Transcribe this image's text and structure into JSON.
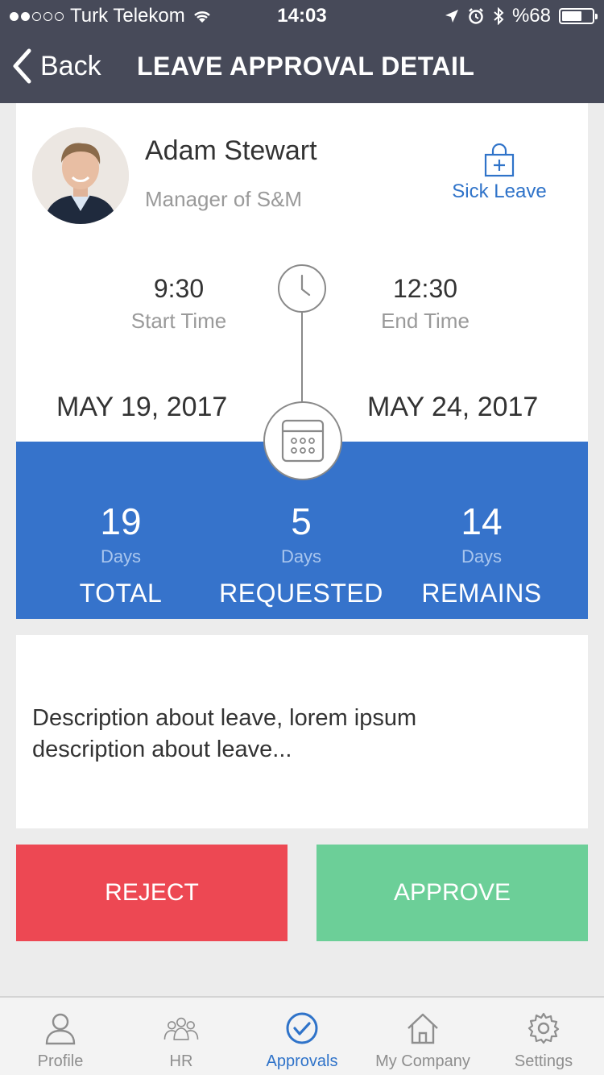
{
  "status_bar": {
    "carrier": "Turk Telekom",
    "time": "14:03",
    "battery": "%68",
    "battery_level": 0.68
  },
  "nav": {
    "back_label": "Back",
    "title": "LEAVE APPROVAL DETAIL"
  },
  "employee": {
    "name": "Adam Stewart",
    "role": "Manager of S&M"
  },
  "leave": {
    "type": "Sick Leave",
    "start_time": "9:30",
    "start_time_label": "Start Time",
    "end_time": "12:30",
    "end_time_label": "End Time",
    "start_date": "MAY 19, 2017",
    "end_date": "MAY 24, 2017"
  },
  "summary": {
    "unit": "Days",
    "total": {
      "value": "19",
      "caption": "TOTAL"
    },
    "requested": {
      "value": "5",
      "caption": "REQUESTED"
    },
    "remains": {
      "value": "14",
      "caption": "REMAINS"
    }
  },
  "description": "Description about leave, lorem ipsum description about leave...",
  "actions": {
    "reject_label": "REJECT",
    "approve_label": "APPROVE"
  },
  "tabs": [
    {
      "label": "Profile",
      "icon": "person-icon",
      "active": false
    },
    {
      "label": "HR",
      "icon": "group-icon",
      "active": false
    },
    {
      "label": "Approvals",
      "icon": "check-circle-icon",
      "active": true
    },
    {
      "label": "My Company",
      "icon": "home-icon",
      "active": false
    },
    {
      "label": "Settings",
      "icon": "gear-icon",
      "active": false
    }
  ],
  "colors": {
    "nav_bg": "#474a59",
    "accent": "#3673cb",
    "reject": "#ed4853",
    "approve": "#6ccf98"
  }
}
